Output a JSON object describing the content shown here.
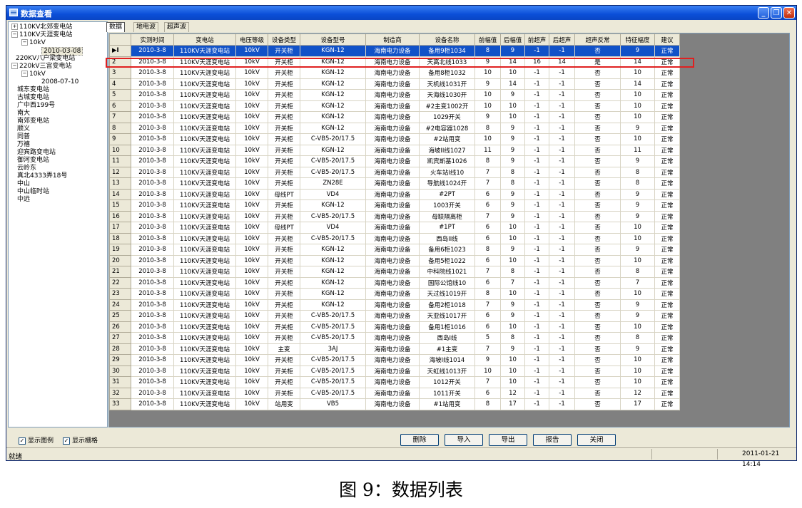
{
  "window": {
    "title": "数据查看"
  },
  "tree": [
    {
      "label": "110KV北郊变电站",
      "exp": "+"
    },
    {
      "label": "110KV天涯变电站",
      "exp": "-"
    },
    {
      "label": "10kV",
      "exp": "-"
    },
    {
      "label": "2010-03-08",
      "exp": ""
    },
    {
      "label": "220KV八户梁变电站",
      "exp": ""
    },
    {
      "label": "220kV三宫变电站",
      "exp": "-"
    },
    {
      "label": "10kV",
      "exp": "-"
    },
    {
      "label": "2008-07-10",
      "exp": ""
    },
    {
      "label": "城东变电站",
      "exp": ""
    },
    {
      "label": "古城变电站",
      "exp": ""
    },
    {
      "label": "广中西199号",
      "exp": ""
    },
    {
      "label": "南大",
      "exp": ""
    },
    {
      "label": "南郊变电站",
      "exp": ""
    },
    {
      "label": "顺义",
      "exp": ""
    },
    {
      "label": "同普",
      "exp": ""
    },
    {
      "label": "万禧",
      "exp": ""
    },
    {
      "label": "迎宾路变电站",
      "exp": ""
    },
    {
      "label": "御河变电站",
      "exp": ""
    },
    {
      "label": "云岭东",
      "exp": ""
    },
    {
      "label": "真北4333弄18号",
      "exp": ""
    },
    {
      "label": "中山",
      "exp": ""
    },
    {
      "label": "中山临时站",
      "exp": ""
    },
    {
      "label": "中远",
      "exp": ""
    }
  ],
  "tabs": [
    "数据",
    "地电波",
    "超声波"
  ],
  "columns": [
    "实测时间",
    "变电站",
    "电压等级",
    "设备类型",
    "设备型号",
    "制造商",
    "设备名称",
    "前幅值",
    "后幅值",
    "前超声",
    "后超声",
    "超声反常",
    "特征幅度",
    "建议"
  ],
  "rows": [
    [
      "2010-3-8",
      "110KV天涯变电站",
      "10kV",
      "开关柜",
      "KGN-12",
      "海南电力设备",
      "备用9柜1034",
      "8",
      "9",
      "-1",
      "-1",
      "否",
      "9",
      "正常"
    ],
    [
      "2010-3-8",
      "110KV天涯变电站",
      "10kV",
      "开关柜",
      "KGN-12",
      "海南电力设备",
      "天高北线1033",
      "9",
      "14",
      "16",
      "14",
      "是",
      "14",
      "正常"
    ],
    [
      "2010-3-8",
      "110KV天涯变电站",
      "10kV",
      "开关柜",
      "KGN-12",
      "海南电力设备",
      "备用8柜1032",
      "10",
      "10",
      "-1",
      "-1",
      "否",
      "10",
      "正常"
    ],
    [
      "2010-3-8",
      "110KV天涯变电站",
      "10kV",
      "开关柜",
      "KGN-12",
      "海南电力设备",
      "天机线1031开",
      "9",
      "14",
      "-1",
      "-1",
      "否",
      "14",
      "正常"
    ],
    [
      "2010-3-8",
      "110KV天涯变电站",
      "10kV",
      "开关柜",
      "KGN-12",
      "海南电力设备",
      "天海线1030开",
      "10",
      "9",
      "-1",
      "-1",
      "否",
      "10",
      "正常"
    ],
    [
      "2010-3-8",
      "110KV天涯变电站",
      "10kV",
      "开关柜",
      "KGN-12",
      "海南电力设备",
      "#2主变1002开",
      "10",
      "10",
      "-1",
      "-1",
      "否",
      "10",
      "正常"
    ],
    [
      "2010-3-8",
      "110KV天涯变电站",
      "10kV",
      "开关柜",
      "KGN-12",
      "海南电力设备",
      "1029开关",
      "9",
      "10",
      "-1",
      "-1",
      "否",
      "10",
      "正常"
    ],
    [
      "2010-3-8",
      "110KV天涯变电站",
      "10kV",
      "开关柜",
      "KGN-12",
      "海南电力设备",
      "#2电容器1028",
      "8",
      "9",
      "-1",
      "-1",
      "否",
      "9",
      "正常"
    ],
    [
      "2010-3-8",
      "110KV天涯变电站",
      "10kV",
      "开关柜",
      "C-VB5-20/17.5",
      "海南电力设备",
      "#2站用变",
      "10",
      "9",
      "-1",
      "-1",
      "否",
      "10",
      "正常"
    ],
    [
      "2010-3-8",
      "110KV天涯变电站",
      "10kV",
      "开关柜",
      "KGN-12",
      "海南电力设备",
      "海坡II线1027",
      "11",
      "9",
      "-1",
      "-1",
      "否",
      "11",
      "正常"
    ],
    [
      "2010-3-8",
      "110KV天涯变电站",
      "10kV",
      "开关柜",
      "C-VB5-20/17.5",
      "海南电力设备",
      "凯宾斯基1026",
      "8",
      "9",
      "-1",
      "-1",
      "否",
      "9",
      "正常"
    ],
    [
      "2010-3-8",
      "110KV天涯变电站",
      "10kV",
      "开关柜",
      "C-VB5-20/17.5",
      "海南电力设备",
      "火车站I线10",
      "7",
      "8",
      "-1",
      "-1",
      "否",
      "8",
      "正常"
    ],
    [
      "2010-3-8",
      "110KV天涯变电站",
      "10kV",
      "开关柜",
      "ZN28E",
      "海南电力设备",
      "导航线1024开",
      "7",
      "8",
      "-1",
      "-1",
      "否",
      "8",
      "正常"
    ],
    [
      "2010-3-8",
      "110KV天涯变电站",
      "10kV",
      "母线PT",
      "VD4",
      "海南电力设备",
      "#2PT",
      "6",
      "9",
      "-1",
      "-1",
      "否",
      "9",
      "正常"
    ],
    [
      "2010-3-8",
      "110KV天涯变电站",
      "10kV",
      "开关柜",
      "KGN-12",
      "海南电力设备",
      "1003开关",
      "6",
      "9",
      "-1",
      "-1",
      "否",
      "9",
      "正常"
    ],
    [
      "2010-3-8",
      "110KV天涯变电站",
      "10kV",
      "开关柜",
      "C-VB5-20/17.5",
      "海南电力设备",
      "母联隔离柜",
      "7",
      "9",
      "-1",
      "-1",
      "否",
      "9",
      "正常"
    ],
    [
      "2010-3-8",
      "110KV天涯变电站",
      "10kV",
      "母线PT",
      "VD4",
      "海南电力设备",
      "#1PT",
      "6",
      "10",
      "-1",
      "-1",
      "否",
      "10",
      "正常"
    ],
    [
      "2010-3-8",
      "110KV天涯变电站",
      "10kV",
      "开关柜",
      "C-VB5-20/17.5",
      "海南电力设备",
      "西岛II线",
      "6",
      "10",
      "-1",
      "-1",
      "否",
      "10",
      "正常"
    ],
    [
      "2010-3-8",
      "110KV天涯变电站",
      "10kV",
      "开关柜",
      "KGN-12",
      "海南电力设备",
      "备用6柜1023",
      "8",
      "9",
      "-1",
      "-1",
      "否",
      "9",
      "正常"
    ],
    [
      "2010-3-8",
      "110KV天涯变电站",
      "10kV",
      "开关柜",
      "KGN-12",
      "海南电力设备",
      "备用5柜1022",
      "6",
      "10",
      "-1",
      "-1",
      "否",
      "10",
      "正常"
    ],
    [
      "2010-3-8",
      "110KV天涯变电站",
      "10kV",
      "开关柜",
      "KGN-12",
      "海南电力设备",
      "中科院线1021",
      "7",
      "8",
      "-1",
      "-1",
      "否",
      "8",
      "正常"
    ],
    [
      "2010-3-8",
      "110KV天涯变电站",
      "10kV",
      "开关柜",
      "KGN-12",
      "海南电力设备",
      "国际公馆线10",
      "6",
      "7",
      "-1",
      "-1",
      "否",
      "7",
      "正常"
    ],
    [
      "2010-3-8",
      "110KV天涯变电站",
      "10kV",
      "开关柜",
      "KGN-12",
      "海南电力设备",
      "天过线1019开",
      "8",
      "10",
      "-1",
      "-1",
      "否",
      "10",
      "正常"
    ],
    [
      "2010-3-8",
      "110KV天涯变电站",
      "10kV",
      "开关柜",
      "KGN-12",
      "海南电力设备",
      "备用2柜1018",
      "7",
      "9",
      "-1",
      "-1",
      "否",
      "9",
      "正常"
    ],
    [
      "2010-3-8",
      "110KV天涯变电站",
      "10kV",
      "开关柜",
      "C-VB5-20/17.5",
      "海南电力设备",
      "天亚线1017开",
      "6",
      "9",
      "-1",
      "-1",
      "否",
      "9",
      "正常"
    ],
    [
      "2010-3-8",
      "110KV天涯变电站",
      "10kV",
      "开关柜",
      "C-VB5-20/17.5",
      "海南电力设备",
      "备用1柜1016",
      "6",
      "10",
      "-1",
      "-1",
      "否",
      "10",
      "正常"
    ],
    [
      "2010-3-8",
      "110KV天涯变电站",
      "10kV",
      "开关柜",
      "C-VB5-20/17.5",
      "海南电力设备",
      "西岛I线",
      "5",
      "8",
      "-1",
      "-1",
      "否",
      "8",
      "正常"
    ],
    [
      "2010-3-8",
      "110KV天涯变电站",
      "10kV",
      "主变",
      "3AJ",
      "海南电力设备",
      "#1主变",
      "7",
      "9",
      "-1",
      "-1",
      "否",
      "9",
      "正常"
    ],
    [
      "2010-3-8",
      "110KV天涯变电站",
      "10kV",
      "开关柜",
      "C-VB5-20/17.5",
      "海南电力设备",
      "海坡I线1014",
      "9",
      "10",
      "-1",
      "-1",
      "否",
      "10",
      "正常"
    ],
    [
      "2010-3-8",
      "110KV天涯变电站",
      "10kV",
      "开关柜",
      "C-VB5-20/17.5",
      "海南电力设备",
      "天虹线1013开",
      "10",
      "10",
      "-1",
      "-1",
      "否",
      "10",
      "正常"
    ],
    [
      "2010-3-8",
      "110KV天涯变电站",
      "10kV",
      "开关柜",
      "C-VB5-20/17.5",
      "海南电力设备",
      "1012开关",
      "7",
      "10",
      "-1",
      "-1",
      "否",
      "10",
      "正常"
    ],
    [
      "2010-3-8",
      "110KV天涯变电站",
      "10kV",
      "开关柜",
      "C-VB5-20/17.5",
      "海南电力设备",
      "1011开关",
      "6",
      "12",
      "-1",
      "-1",
      "否",
      "12",
      "正常"
    ],
    [
      "2010-3-8",
      "110KV天涯变电站",
      "10kV",
      "站用变",
      "VB5",
      "海南电力设备",
      "#1站用变",
      "8",
      "17",
      "-1",
      "-1",
      "否",
      "17",
      "正常"
    ]
  ],
  "selected_row_marker": "▶I",
  "options": {
    "show_legend": "显示图例",
    "show_grid": "显示栅格"
  },
  "buttons": {
    "delete": "删除",
    "import": "导入",
    "export": "导出",
    "report": "报告",
    "close": "关闭"
  },
  "status": {
    "text": "就绪",
    "datetime": "2011-01-21 14:14"
  },
  "caption": "图 9：数据列表"
}
